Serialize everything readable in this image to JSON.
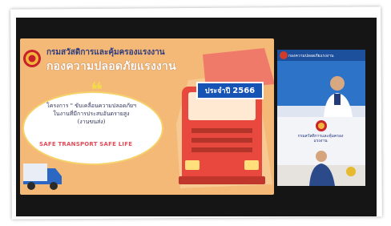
{
  "slide": {
    "org_name_top": "กรมสวัสดิการและคุ้มครองแรงงาน",
    "org_name_main": "กองความปลอดภัยแรงงาน",
    "year_prefix": "ประจำปี",
    "year_value": "2566",
    "project_line1": "โครงการ \" ขับเคลื่อนความปลอดภัยฯ",
    "project_line2": "ในงานที่มีการประสบอันตรายสูง",
    "project_line3": "(งานขนส่ง)",
    "tagline": "SAFE TRANSPORT SAFE LIFE"
  },
  "participants": [
    {
      "caption": "กองความปลอดภัยแรงงาน"
    },
    {
      "caption": "กรมสวัสดิการและคุ้มครองแรงงาน"
    }
  ],
  "colors": {
    "slide_background": "#f4b977",
    "truck_red": "#e8483d",
    "badge_blue": "#1553b5",
    "org_text_blue": "#2f3b7f",
    "tagline_red": "#e24b58"
  }
}
